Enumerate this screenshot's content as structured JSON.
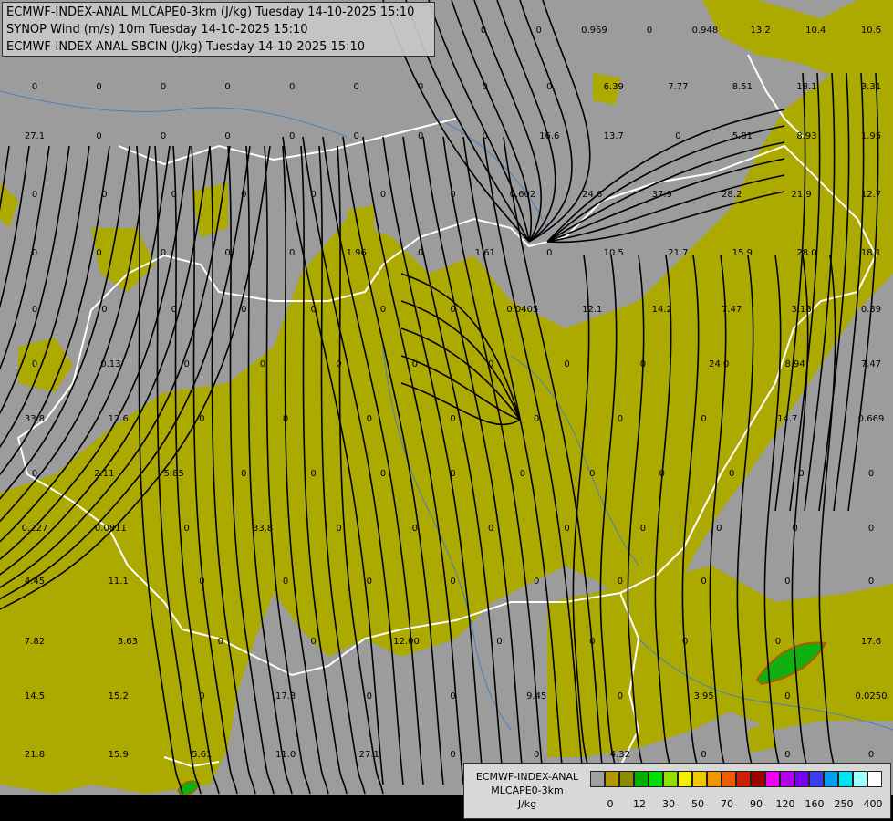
{
  "header": {
    "lines": [
      "ECMWF-INDEX-ANAL MLCAPE0-3km (J/kg) Tuesday 14-10-2025 15:10",
      "SYNOP Wind (m/s) 10m Tuesday 14-10-2025 15:10",
      "ECMWF-INDEX-ANAL SBCIN (J/kg) Tuesday 14-10-2025 15:10"
    ]
  },
  "legend": {
    "title": "ECMWF-INDEX-ANAL",
    "subtitle": "MLCAPE0-3km",
    "unit": "J/kg",
    "colors": [
      "#a0a0a0",
      "#b09a00",
      "#8c8c00",
      "#00b000",
      "#00e000",
      "#90e000",
      "#f0f000",
      "#f0c800",
      "#f09600",
      "#f05a00",
      "#d01e00",
      "#a00000",
      "#f000f0",
      "#b400f0",
      "#7800f0",
      "#3c3cf0",
      "#00a0f0",
      "#00e6f0",
      "#a0ffff",
      "#ffffff"
    ],
    "ticks": [
      "0",
      "12",
      "30",
      "50",
      "70",
      "90",
      "120",
      "160",
      "250",
      "400"
    ]
  },
  "palette": {
    "background": "#9c9c9c",
    "cape_low": "#acaa00",
    "cape_mid": "#10b010",
    "border": "#ffffff",
    "rivers": "#4a7fbf",
    "streamline": "#000000"
  },
  "values": {
    "row1": [
      "0",
      "0",
      "0.969",
      "0",
      "0.948",
      "13.2",
      "10.4",
      "10.6"
    ],
    "row2": [
      "0",
      "0",
      "0",
      "0",
      "0",
      "0",
      "0",
      "0",
      "0",
      "6.39",
      "7.77",
      "8.51",
      "18.1",
      "3.31"
    ],
    "row3": [
      "27.1",
      "0",
      "0",
      "0",
      "0",
      "0",
      "0",
      "0",
      "16.6",
      "13.7",
      "0",
      "5.81",
      "8.93",
      "1.95"
    ],
    "row4": [
      "0",
      "0",
      "0",
      "0",
      "0",
      "0",
      "0",
      "0.602",
      "24.6",
      "37.9",
      "28.2",
      "21.9",
      "12.7"
    ],
    "row5": [
      "0",
      "0",
      "0",
      "0",
      "0",
      "1.96",
      "0",
      "1.61",
      "0",
      "10.5",
      "21.7",
      "15.9",
      "28.0",
      "18.1"
    ],
    "row6": [
      "0",
      "0",
      "0",
      "0",
      "0",
      "0",
      "0",
      "0.0405",
      "12.1",
      "14.2",
      "7.47",
      "3.18",
      "0.39"
    ],
    "row7": [
      "0",
      "0.13",
      "0",
      "0",
      "0",
      "0",
      "0",
      "0",
      "0",
      "24.0",
      "8.94",
      "7.47"
    ],
    "row8": [
      "33.8",
      "12.6",
      "0",
      "0",
      "0",
      "0",
      "0",
      "0",
      "0",
      "14.7",
      "0.669"
    ],
    "row9": [
      "0",
      "2.11",
      "5.85",
      "0",
      "0",
      "0",
      "0",
      "0",
      "0",
      "0",
      "0",
      "0",
      "0"
    ],
    "row10": [
      "0.227",
      "0.0811",
      "0",
      "33.8",
      "0",
      "0",
      "0",
      "0",
      "0",
      "0",
      "0",
      "0"
    ],
    "row11": [
      "4.45",
      "11.1",
      "0",
      "0",
      "0",
      "0",
      "0",
      "0",
      "0",
      "0",
      "0"
    ],
    "row12": [
      "7.82",
      "3.63",
      "0",
      "0",
      "12.00",
      "0",
      "0",
      "0",
      "0",
      "17.6"
    ],
    "row13": [
      "14.5",
      "15.2",
      "0",
      "17.3",
      "0",
      "0",
      "9.45",
      "0",
      "3.95",
      "0",
      "0.0250"
    ],
    "row14": [
      "21.8",
      "15.9",
      "5.61",
      "11.0",
      "27.1",
      "0",
      "0",
      "4.32",
      "0",
      "0",
      "0"
    ]
  }
}
